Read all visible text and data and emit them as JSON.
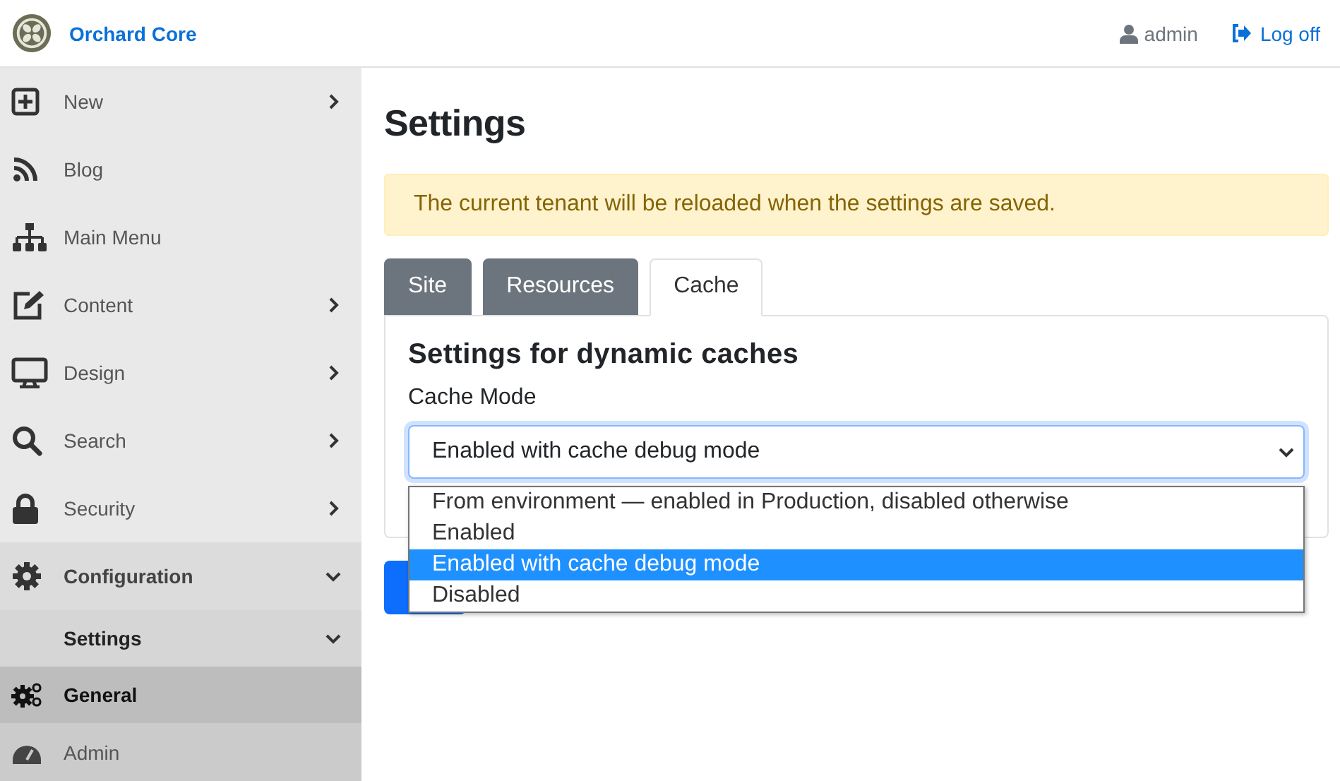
{
  "header": {
    "brand": "Orchard Core",
    "user": "admin",
    "logoff": "Log off"
  },
  "sidebar": {
    "items": [
      {
        "label": "New",
        "expanded": false,
        "selected": false
      },
      {
        "label": "Blog",
        "selected": false
      },
      {
        "label": "Main Menu",
        "selected": false
      },
      {
        "label": "Content",
        "expanded": false,
        "selected": false
      },
      {
        "label": "Design",
        "expanded": false,
        "selected": false
      },
      {
        "label": "Search",
        "expanded": false,
        "selected": false
      },
      {
        "label": "Security",
        "expanded": false,
        "selected": false
      },
      {
        "label": "Configuration",
        "expanded": true,
        "selected": false,
        "children": [
          {
            "label": "Settings",
            "expanded": true,
            "selected": false,
            "children": [
              {
                "label": "General",
                "selected": true
              },
              {
                "label": "Admin",
                "selected": false
              }
            ]
          }
        ]
      }
    ]
  },
  "page": {
    "title": "Settings",
    "alert": "The current tenant will be reloaded when the settings are saved.",
    "tabs": [
      {
        "label": "Site",
        "selected": false
      },
      {
        "label": "Resources",
        "selected": false
      },
      {
        "label": "Cache",
        "selected": true
      }
    ],
    "panel_heading": "Settings for dynamic caches",
    "field_label": "Cache Mode",
    "select": {
      "value": "Enabled with cache debug mode",
      "expanded": true,
      "options": [
        {
          "label": "From environment — enabled in Production, disabled otherwise",
          "selected": false
        },
        {
          "label": "Enabled",
          "selected": false
        },
        {
          "label": "Enabled with cache debug mode",
          "selected": true
        },
        {
          "label": "Disabled",
          "selected": false
        }
      ]
    }
  }
}
